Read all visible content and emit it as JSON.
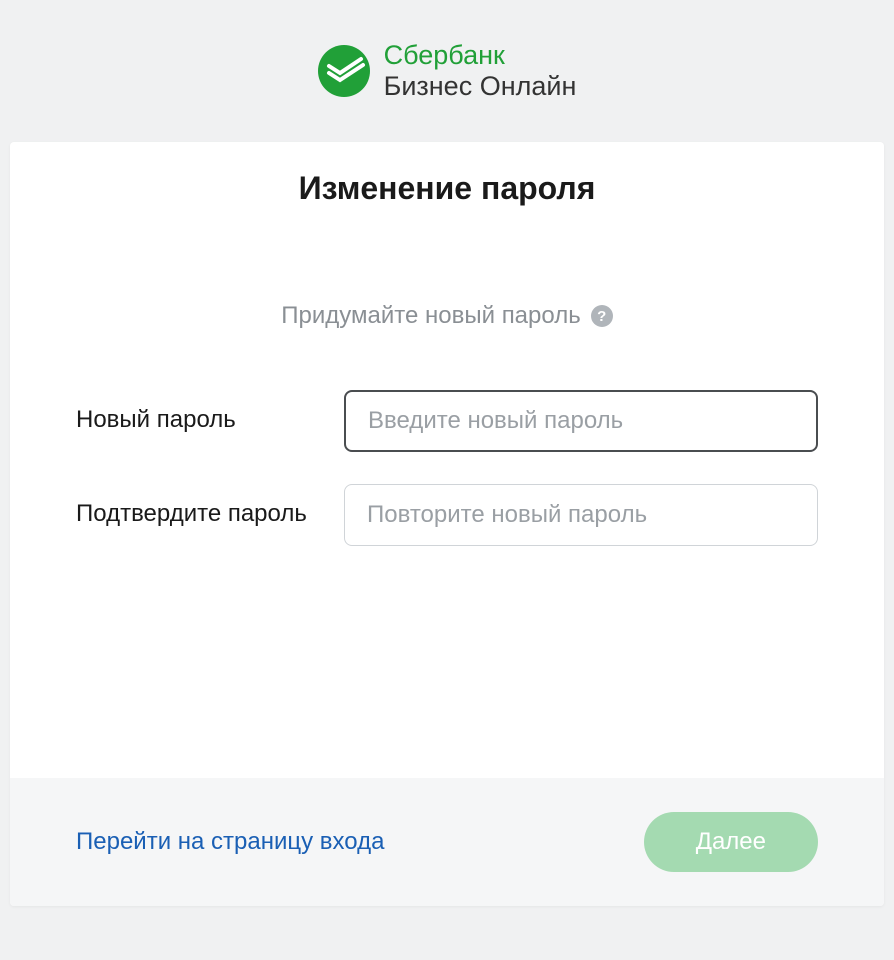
{
  "header": {
    "brand_line1": "Сбербанк",
    "brand_line2": "Бизнес Онлайн"
  },
  "main": {
    "title": "Изменение пароля",
    "subtitle": "Придумайте новый пароль",
    "fields": {
      "new_password": {
        "label": "Новый пароль",
        "placeholder": "Введите новый пароль",
        "value": ""
      },
      "confirm_password": {
        "label": "Подтвердите пароль",
        "placeholder": "Повторите новый пароль",
        "value": ""
      }
    }
  },
  "footer": {
    "back_link": "Перейти на страницу входа",
    "next_button": "Далее"
  },
  "colors": {
    "brand_green": "#21a038",
    "disabled_green": "#a4dab1",
    "link_blue": "#1a5fb4"
  }
}
